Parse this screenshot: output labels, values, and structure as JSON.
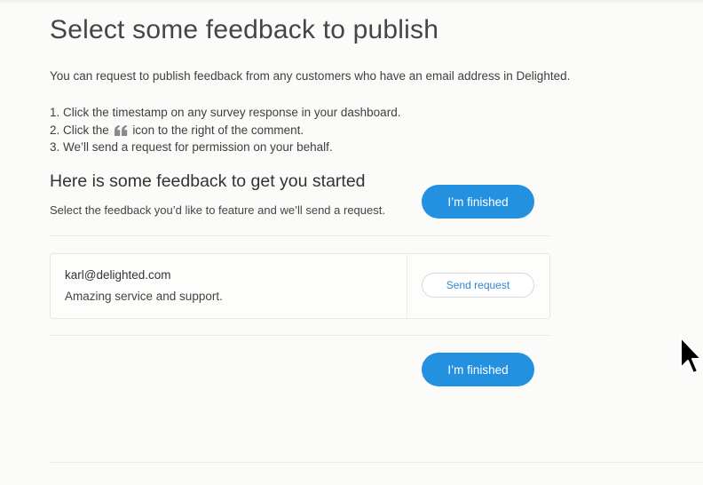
{
  "header": {
    "title": "Select some feedback to publish",
    "intro": "You can request to publish feedback from any customers who have an email address in Delighted."
  },
  "steps": [
    {
      "text": "1. Click the timestamp on any survey response in your dashboard."
    },
    {
      "before": "2. Click the",
      "icon": "quote-icon",
      "after": "icon to the right of the comment."
    },
    {
      "text": "3. We’ll send a request for permission on your behalf."
    }
  ],
  "section": {
    "title": "Here is some feedback to get you started",
    "subtitle": "Select the feedback you’d like to feature and we’ll send a request.",
    "finished_label": "I’m finished"
  },
  "feedback": [
    {
      "email": "karl@delighted.com",
      "comment": "Amazing service and support.",
      "action_label": "Send request"
    }
  ],
  "footer": {
    "finished_label": "I’m finished"
  },
  "colors": {
    "accent": "#2491e0",
    "link": "#2f86cf",
    "background": "#fbfbf9"
  },
  "icons": {
    "cursor": "mouse-pointer-icon",
    "quote": "quote-icon"
  }
}
